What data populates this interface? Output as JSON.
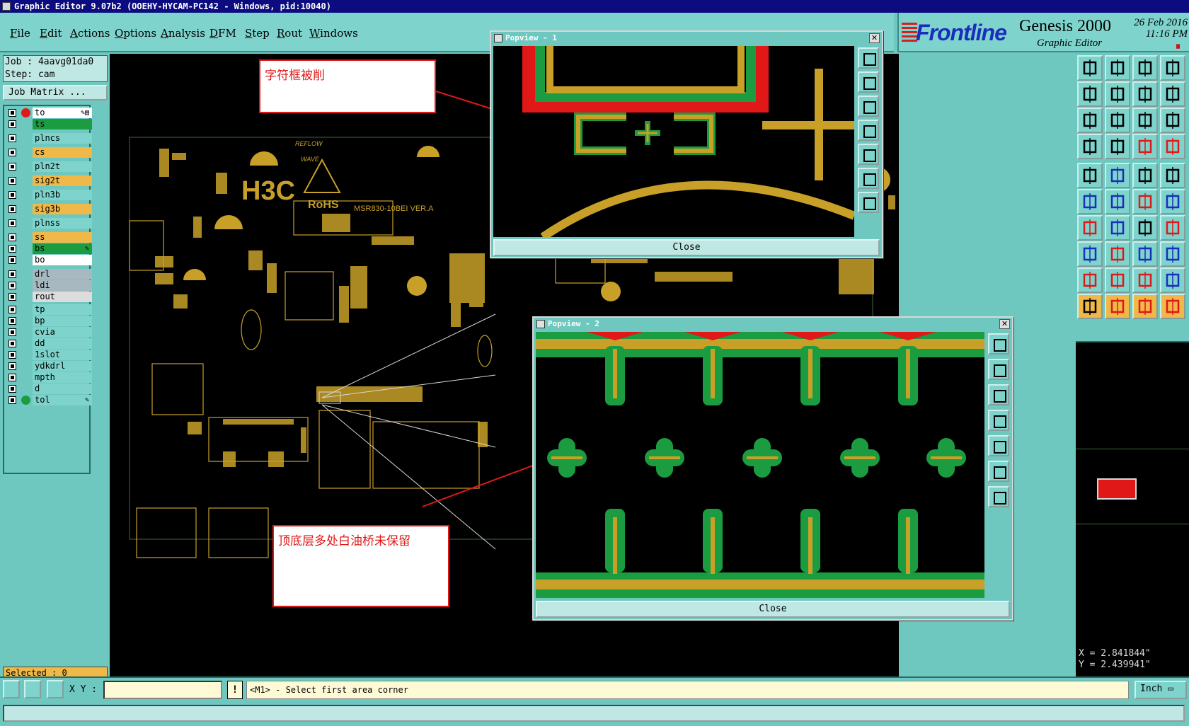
{
  "window": {
    "title": "Graphic Editor 9.07b2 (OOEHY-HYCAM-PC142 - Windows, pid:10040)"
  },
  "menu": [
    "File",
    "Edit",
    "Actions",
    "Options",
    "Analysis",
    "DFM",
    "Step",
    "Rout",
    "Windows"
  ],
  "brand": {
    "logo": "Frontline",
    "product": "Genesis 2000",
    "subtitle": "Graphic Editor",
    "date": "26 Feb 2016",
    "time": "11:16 PM",
    "pause": "⏸"
  },
  "job": {
    "job_line": "Job : 4aavg01da0",
    "step_line": "Step: cam",
    "matrix_button": "Job Matrix ..."
  },
  "layers": [
    {
      "name": "to",
      "color": "#ffffff",
      "dot": "#e01818",
      "mark": "✎▤"
    },
    {
      "name": "ts",
      "color": "#1c9c40",
      "dot": "",
      "mark": ""
    },
    {
      "name": "plncs",
      "color": "#7ed4cc",
      "dot": "",
      "mark": ""
    },
    {
      "name": "cs",
      "color": "#f0b848",
      "dot": "",
      "mark": ""
    },
    {
      "name": "pln2t",
      "color": "#7ed4cc",
      "dot": "",
      "mark": ""
    },
    {
      "name": "sig2t",
      "color": "#f0b848",
      "dot": "",
      "mark": ""
    },
    {
      "name": "pln3b",
      "color": "#7ed4cc",
      "dot": "",
      "mark": ""
    },
    {
      "name": "sig3b",
      "color": "#f0b848",
      "dot": "",
      "mark": ""
    },
    {
      "name": "plnss",
      "color": "#7ed4cc",
      "dot": "",
      "mark": ""
    },
    {
      "name": "ss",
      "color": "#f0b848",
      "dot": "",
      "mark": ""
    },
    {
      "name": "bs",
      "color": "#1c9c40",
      "dot": "",
      "mark": "✎"
    },
    {
      "name": "bo",
      "color": "#ffffff",
      "dot": "",
      "mark": ""
    },
    {
      "name": "drl",
      "color": "#a8b8c0",
      "dot": "",
      "mark": ""
    },
    {
      "name": "ldi",
      "color": "#a8b8c0",
      "dot": "",
      "mark": ""
    },
    {
      "name": "rout",
      "color": "#dcdcdc",
      "dot": "",
      "mark": ""
    },
    {
      "name": "tp",
      "color": "#7ed4cc",
      "dot": "",
      "mark": ""
    },
    {
      "name": "bp",
      "color": "#7ed4cc",
      "dot": "",
      "mark": ""
    },
    {
      "name": "cvia",
      "color": "#7ed4cc",
      "dot": "",
      "mark": ""
    },
    {
      "name": "dd",
      "color": "#7ed4cc",
      "dot": "",
      "mark": ""
    },
    {
      "name": "1slot",
      "color": "#7ed4cc",
      "dot": "",
      "mark": ""
    },
    {
      "name": "ydkdrl",
      "color": "#7ed4cc",
      "dot": "",
      "mark": ""
    },
    {
      "name": "mpth",
      "color": "#7ed4cc",
      "dot": "",
      "mark": ""
    },
    {
      "name": "d",
      "color": "#7ed4cc",
      "dot": "",
      "mark": ""
    },
    {
      "name": "tol",
      "color": "#7ed4cc",
      "dot": "#1c9c40",
      "mark": "✎"
    }
  ],
  "selected": "Selected : 0",
  "board": {
    "logo": "H3C",
    "rohs": "RoHS",
    "part": "MSR830-10BEI VER.A",
    "reflow": "REFLOW",
    "wave": "WAVE"
  },
  "popview1": {
    "title": "Popview - 1",
    "close": "Close"
  },
  "popview2": {
    "title": "Popview - 2",
    "close": "Close"
  },
  "annotations": {
    "a1": "字符框被削",
    "a2": "顶底层多处白油桥未保留"
  },
  "coords": {
    "x": "X = 2.841844\"",
    "y": "Y = 2.439941\""
  },
  "status": {
    "xy_label": "X Y :",
    "excl": "!",
    "prompt": "<M1> - Select first area corner",
    "units": "Inch ▭"
  },
  "icons": {
    "toolbar": [
      "fit-icon",
      "zoom-in-icon",
      "home-icon",
      "zoom-area-icon",
      "pan-left-icon",
      "pan-right-icon",
      "pan-zoom-icon",
      "redraw-icon",
      "center-icon",
      "move-icon",
      "scale-icon",
      "help-icon",
      "measure-icon",
      "grid-icon",
      "snap-icon",
      "snap2-icon",
      "select-icon",
      "feature-icon",
      "ruler-icon",
      "pad-icon",
      "netlist-icon",
      "cross-icon",
      "connect-icon",
      "route-icon",
      "line-icon",
      "arc-icon",
      "rotate-icon",
      "split-icon",
      "delete-icon",
      "minus-icon",
      "resize-icon",
      "copy-icon",
      "text-icon",
      "text2-icon",
      "text3-icon",
      "text4-icon",
      "pointer-icon",
      "pointer2-icon",
      "pointer3-icon",
      "pointer4-icon"
    ]
  }
}
